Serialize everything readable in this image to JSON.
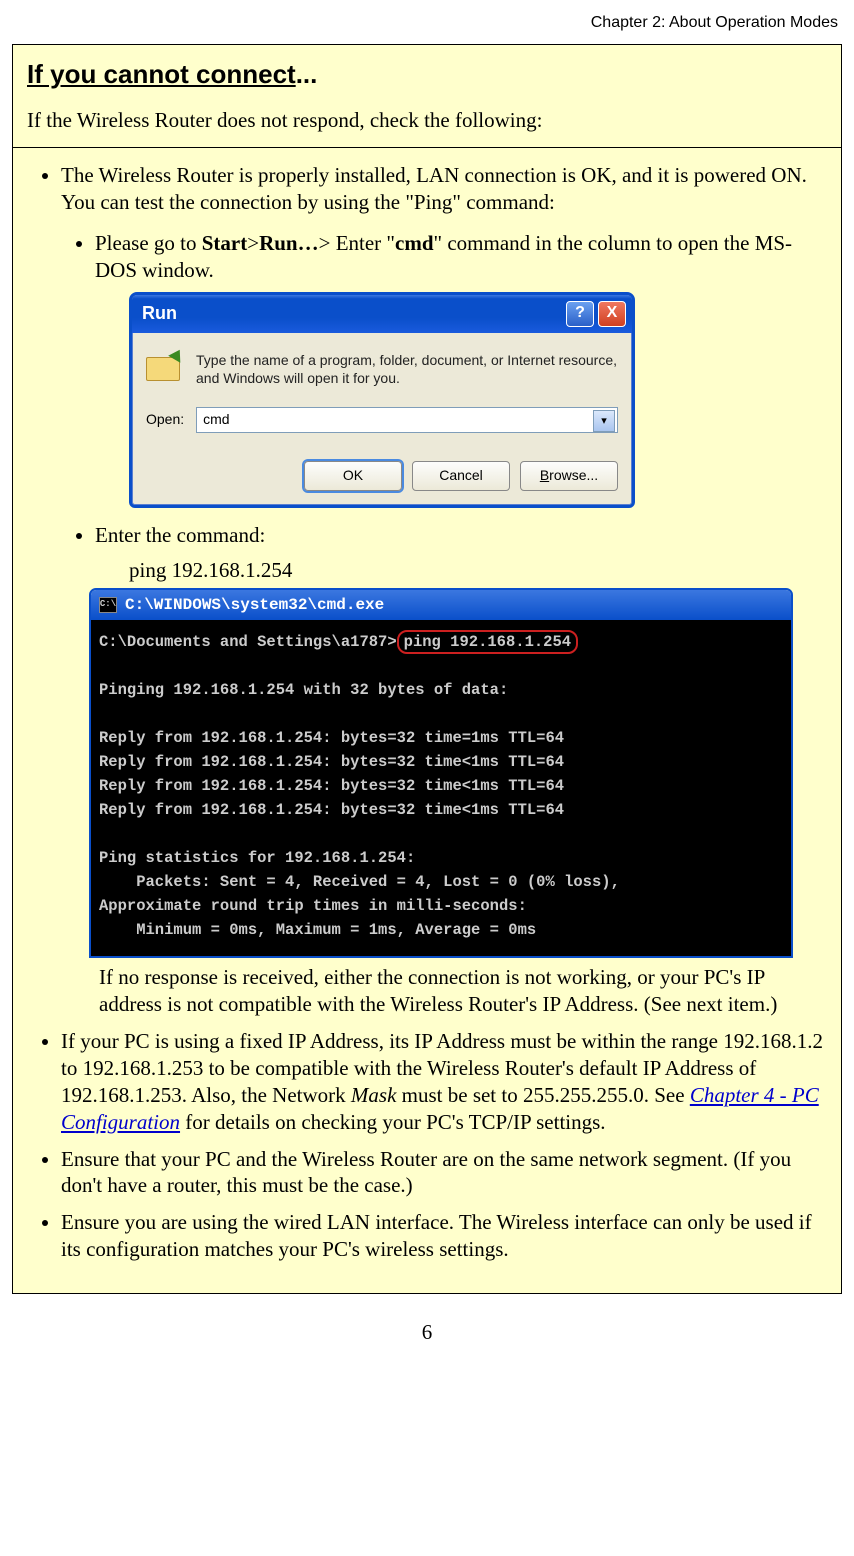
{
  "chapter_header": "Chapter 2: About Operation Modes",
  "note": {
    "title_underlined": "If you cannot connect",
    "title_suffix": "...",
    "intro": "If the Wireless Router does not respond, check the following:",
    "bullet1_prefix": "The Wireless Router is properly installed, LAN connection is OK, and it is powered ON. You can test the connection by using the \"Ping\" command:",
    "sub1_a": "Please go to ",
    "sub1_start": "Start",
    "sub1_gt1": ">",
    "sub1_run": "Run…",
    "sub1_gt2": "> Enter \"",
    "sub1_cmd": "cmd",
    "sub1_tail": "\" command in the column to open the MS-DOS window.",
    "sub2_a": "Enter the command:",
    "sub2_b": "ping 192.168.1.254",
    "after_cmd": "If no response is received, either the connection is not working, or your PC's IP address is not compatible with the Wireless Router's IP Address. (See next item.)",
    "bullet2_a": "If your PC is using a fixed IP Address, its IP Address must be within the range 192.168.1.2 to 192.168.1.253 to be compatible with the Wireless Router's default IP Address of 192.168.1.253. Also, the Network ",
    "bullet2_mask": "Mask",
    "bullet2_b": " must be set to 255.255.255.0. See ",
    "bullet2_link": "Chapter 4 - PC Configuration",
    "bullet2_c": " for details on checking your PC's TCP/IP settings.",
    "bullet3": "Ensure that your PC and the Wireless Router are on the same network segment. (If you don't have a router, this must be the case.)",
    "bullet4": "Ensure you are using the wired LAN interface. The Wireless interface can only be used if its configuration matches your PC's wireless settings."
  },
  "run_dialog": {
    "title": "Run",
    "help_glyph": "?",
    "close_glyph": "X",
    "description": "Type the name of a program, folder, document, or Internet resource, and Windows will open it for you.",
    "open_label": "Open:",
    "open_value": "cmd",
    "chevron": "▾",
    "ok": "OK",
    "cancel": "Cancel",
    "browse": "Browse..."
  },
  "cmd_window": {
    "icon_glyph": "C:\\",
    "title": "C:\\WINDOWS\\system32\\cmd.exe",
    "prompt_prefix": "C:\\Documents and Settings\\a1787>",
    "prompt_cmd": "ping 192.168.1.254",
    "line_blank": "",
    "line_pinging": "Pinging 192.168.1.254 with 32 bytes of data:",
    "reply1": "Reply from 192.168.1.254: bytes=32 time=1ms TTL=64",
    "reply2": "Reply from 192.168.1.254: bytes=32 time<1ms TTL=64",
    "reply3": "Reply from 192.168.1.254: bytes=32 time<1ms TTL=64",
    "reply4": "Reply from 192.168.1.254: bytes=32 time<1ms TTL=64",
    "stats1": "Ping statistics for 192.168.1.254:",
    "stats2": "    Packets: Sent = 4, Received = 4, Lost = 0 (0% loss),",
    "stats3": "Approximate round trip times in milli-seconds:",
    "stats4": "    Minimum = 0ms, Maximum = 1ms, Average = 0ms"
  },
  "page_number": "6"
}
